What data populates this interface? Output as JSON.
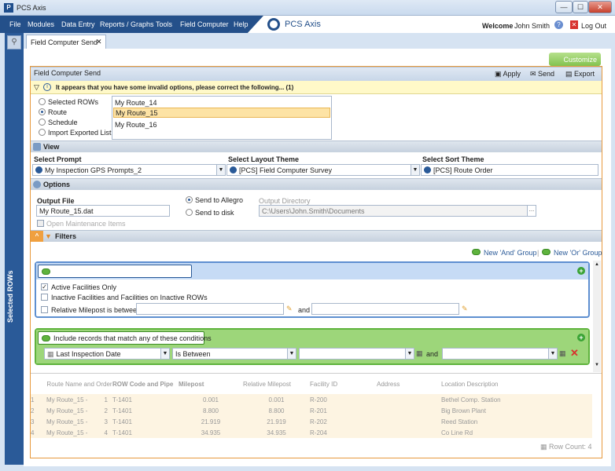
{
  "window": {
    "title": "PCS Axis",
    "min": "—",
    "max": "☐",
    "close": "✕"
  },
  "menu": {
    "items": [
      "File",
      "Modules",
      "Data Entry",
      "Reports / Graphs",
      "Tools",
      "Field Computer",
      "Help"
    ],
    "logo": "PCS Axis",
    "welcome": "Welcome",
    "user": "John Smith",
    "logout": "Log Out"
  },
  "sidebar": {
    "label": "Selected ROWs"
  },
  "tab": {
    "label": "Field Computer Send",
    "close": "✕"
  },
  "toolbar": {
    "customize": "Customize",
    "panel_title": "Field Computer Send",
    "apply": "Apply",
    "send": "Send",
    "export": "Export"
  },
  "warning": "It appears that you have some invalid options, please correct the following... (1)",
  "selection": {
    "options": [
      "Selected ROWs",
      "Route",
      "Schedule",
      "Import Exported List"
    ],
    "routes": [
      "My Route_14",
      "My Route_15",
      "My Route_16"
    ]
  },
  "view": {
    "head": "View",
    "prompt_label": "Select Prompt",
    "prompt_value": "My Inspection GPS Prompts_2",
    "layout_label": "Select Layout Theme",
    "layout_value": "[PCS] Field Computer Survey",
    "sort_label": "Select Sort Theme",
    "sort_value": "[PCS] Route Order"
  },
  "options": {
    "head": "Options",
    "output_label": "Output File",
    "output_value": "My Route_15.dat",
    "send_allegro": "Send to Allegro",
    "send_disk": "Send to disk",
    "dir_label": "Output Directory",
    "dir_value": "C:\\Users\\John.Smith\\Documents",
    "open_maint": "Open Maintenance Items"
  },
  "filters": {
    "head": "Filters",
    "new_and": "New 'And' Group",
    "new_or": "New 'Or' Group",
    "and_group": {
      "items": [
        "Active Facilities Only",
        "Inactive Facilities and Facilities on Inactive ROWs",
        "Relative Milepost is between"
      ],
      "and": "and"
    },
    "or_group": {
      "title": "Include records that match any of these conditions",
      "field": "Last Inspection Date",
      "op": "Is Between",
      "and": "and"
    }
  },
  "grid": {
    "headers": [
      "Route Name and Order",
      "ROW Code and Pipe",
      "Milepost",
      "Relative Milepost",
      "Facility ID",
      "Address",
      "Location Description"
    ],
    "rows": [
      {
        "n": "1",
        "route": "My Route_15 -",
        "order": "1",
        "row": "T-1401",
        "mp": "0.001",
        "rmp": "0.001",
        "fid": "R-200",
        "addr": "",
        "loc": "Bethel Comp. Station"
      },
      {
        "n": "2",
        "route": "My Route_15 -",
        "order": "2",
        "row": "T-1401",
        "mp": "8.800",
        "rmp": "8.800",
        "fid": "R-201",
        "addr": "",
        "loc": "Big Brown Plant"
      },
      {
        "n": "3",
        "route": "My Route_15 -",
        "order": "3",
        "row": "T-1401",
        "mp": "21.919",
        "rmp": "21.919",
        "fid": "R-202",
        "addr": "",
        "loc": "Reed Station"
      },
      {
        "n": "4",
        "route": "My Route_15 -",
        "order": "4",
        "row": "T-1401",
        "mp": "34.935",
        "rmp": "34.935",
        "fid": "R-204",
        "addr": "",
        "loc": "Co Line Rd"
      }
    ],
    "row_count": "Row Count: 4"
  }
}
